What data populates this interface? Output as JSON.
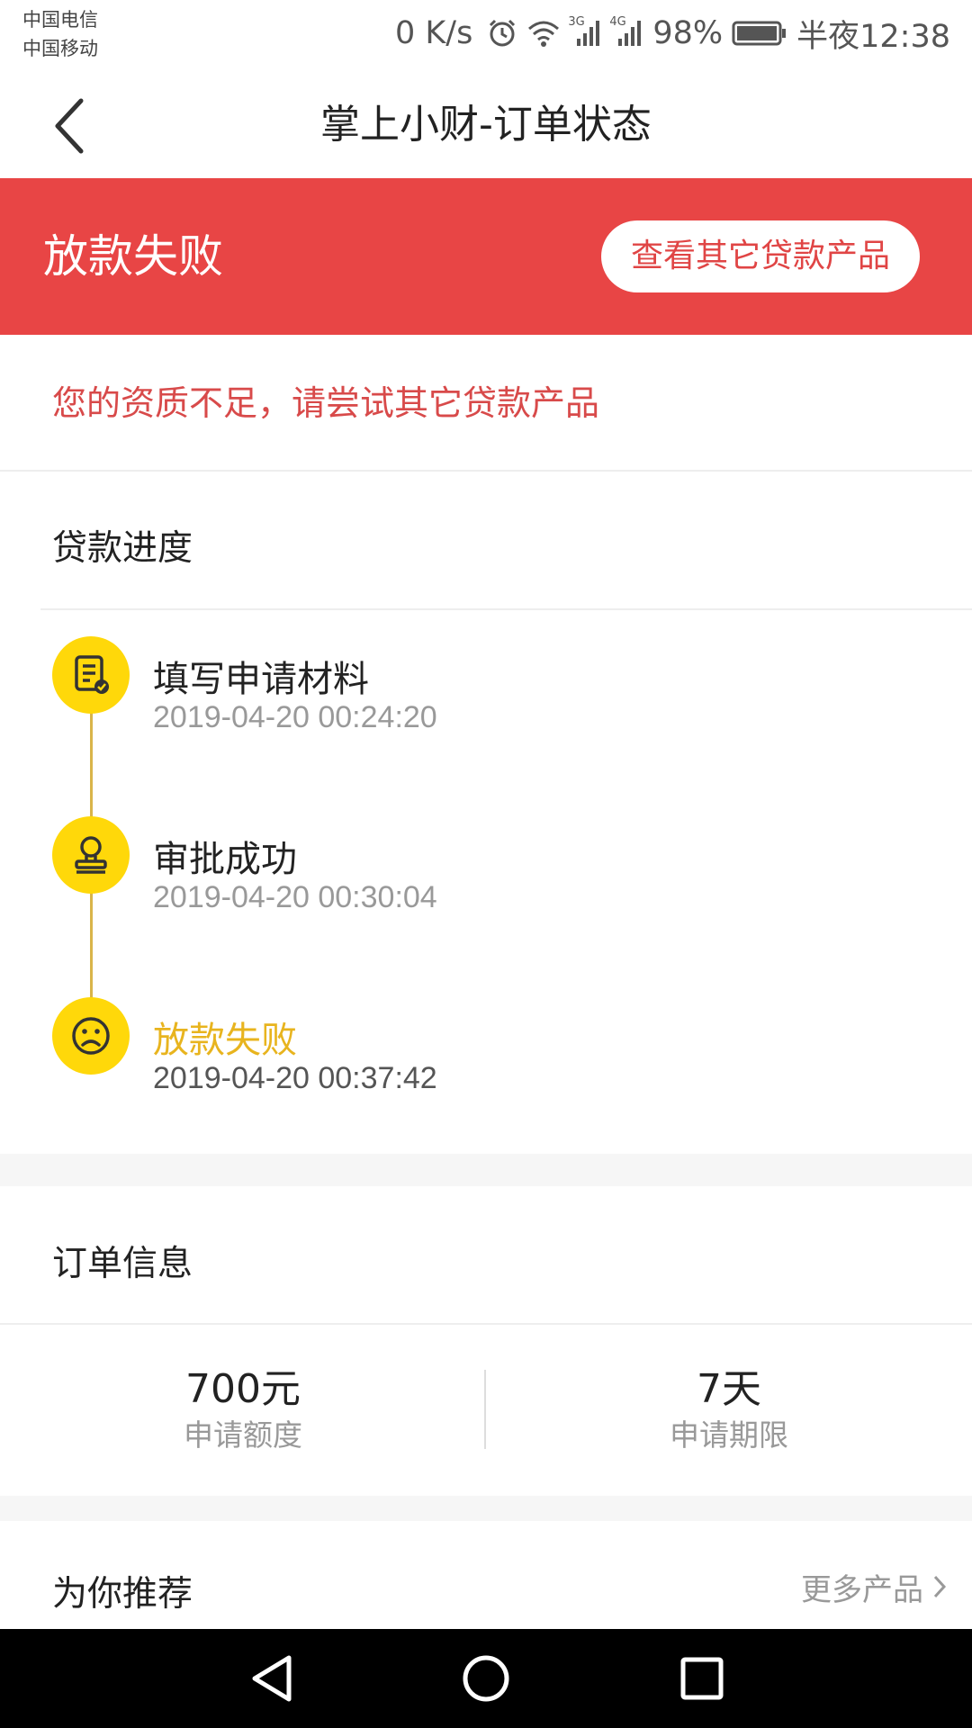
{
  "status_bar": {
    "carrier_1": "中国电信",
    "carrier_2": "中国移动",
    "net_speed": "0 K/s",
    "signal_1_label": "3G",
    "signal_2_label": "4G",
    "battery": "98%",
    "time": "半夜12:38"
  },
  "header": {
    "title": "掌上小财-订单状态"
  },
  "banner": {
    "status": "放款失败",
    "button_label": "查看其它贷款产品",
    "color": "#e84545"
  },
  "notice": {
    "text": "您的资质不足，请尝试其它贷款产品"
  },
  "progress": {
    "title": "贷款进度",
    "steps": [
      {
        "label": "填写申请材料",
        "time": "2019-04-20 00:24:20",
        "icon": "document-check-icon"
      },
      {
        "label": "审批成功",
        "time": "2019-04-20 00:30:04",
        "icon": "stamp-icon"
      },
      {
        "label": "放款失败",
        "time": "2019-04-20 00:37:42",
        "icon": "sad-face-icon"
      }
    ],
    "accent": "#ffd80a"
  },
  "order_info": {
    "title": "订单信息",
    "amount_value": "700元",
    "amount_label": "申请额度",
    "term_value": "7天",
    "term_label": "申请期限"
  },
  "recommend": {
    "title": "为你推荐",
    "more_label": "更多产品"
  }
}
